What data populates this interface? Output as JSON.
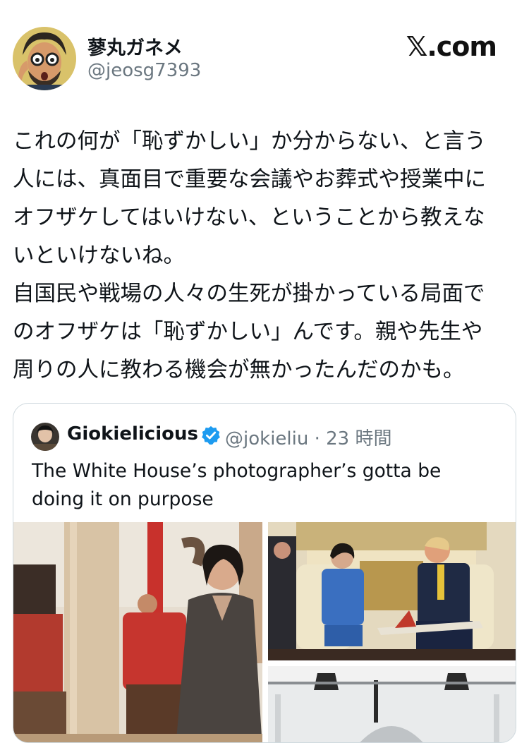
{
  "author": {
    "display_name": "蓼丸ガネメ",
    "handle": "@jeosg7393",
    "avatar_icon": "cartoon-man-avatar"
  },
  "site_label": "𝕏.com",
  "post": {
    "text": "これの何が「恥ずかしい」か分からない、と言う\n人には、真面目で重要な会議やお葬式や授業中に\nオフザケしてはいけない、ということから教えな\nいといけないね。\n自国民や戦場の人々の生死が掛かっている局面で\nのオフザケは「恥ずかしい」んです。親や先生や\n周りの人に教わる機会が無かったんだのかも。"
  },
  "quoted": {
    "display_name": "Giokielicious",
    "verified_icon": "verified-badge-icon",
    "meta": "@jokieliu · 23 時間",
    "text": "The White House’s photographer’s gotta be doing it on purpose",
    "photos": [
      "photo-woman-cheering",
      "photo-oval-office-meeting",
      "photo-white-house-exterior"
    ]
  },
  "colors": {
    "text": "#0f1419",
    "secondary": "#6b7780",
    "border": "#cfd9de",
    "verified": "#1d9bf0"
  }
}
